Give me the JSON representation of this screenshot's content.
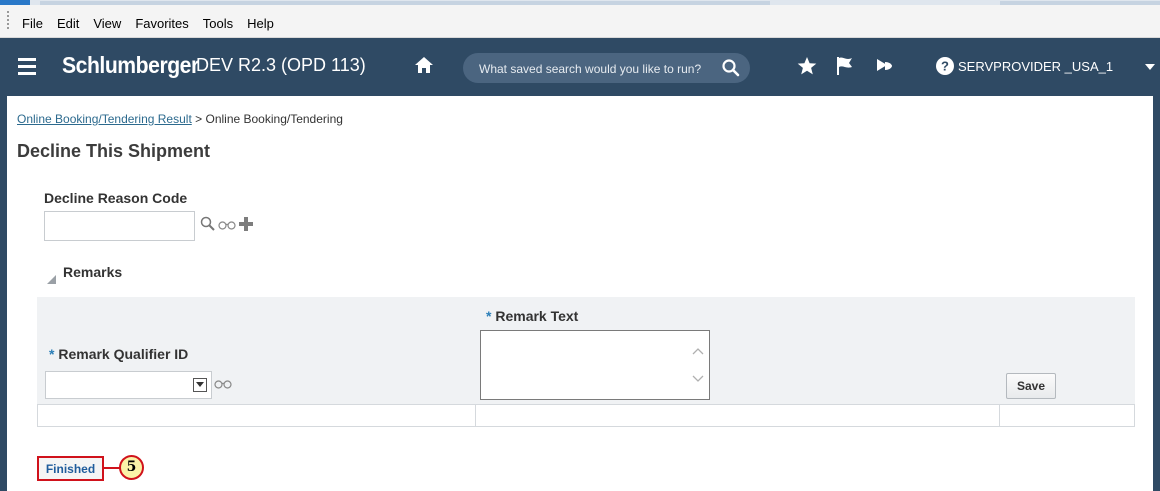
{
  "browser_menu": {
    "items": [
      "File",
      "Edit",
      "View",
      "Favorites",
      "Tools",
      "Help"
    ]
  },
  "header": {
    "brand": "Schlumberger",
    "environment": "DEV R2.3 (OPD 113)",
    "search_placeholder": "What saved search would you like to run?",
    "user": "SERVPROVIDER _USA_1",
    "icons": [
      "menu-icon",
      "home-icon",
      "search-icon",
      "star-icon",
      "flag-icon",
      "bell-icon",
      "help-icon"
    ],
    "color": "#2f4a64"
  },
  "breadcrumb": {
    "link": "Online Booking/Tendering Result",
    "separator": ">",
    "current": "Online Booking/Tendering"
  },
  "page_title": "Decline This Shipment",
  "decline_reason": {
    "label": "Decline Reason Code",
    "value": ""
  },
  "remarks": {
    "title": "Remarks",
    "qualifier_required": "*",
    "qualifier_label": "Remark Qualifier ID",
    "qualifier_value": "",
    "text_required": "*",
    "text_label": "Remark Text",
    "text_value": "",
    "save_label": "Save"
  },
  "finished_label": "Finished",
  "step_number": "5",
  "accent_red": "#d0121b"
}
